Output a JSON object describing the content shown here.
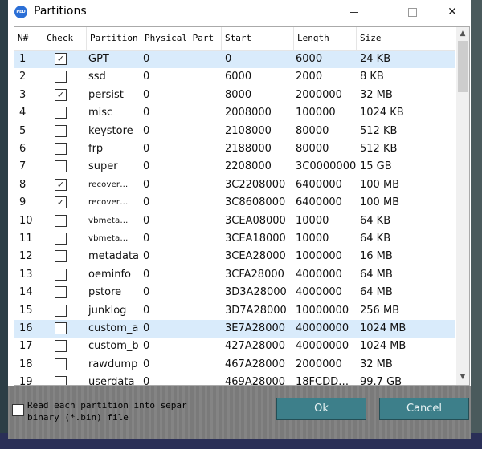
{
  "window": {
    "title": "Partitions",
    "icon_text": "PED"
  },
  "columns": [
    "N#",
    "Check",
    "Partition",
    "Physical Part",
    "Start",
    "Length",
    "Size"
  ],
  "rows": [
    {
      "n": "1",
      "checked": true,
      "partition": "GPT",
      "phys": "0",
      "start": "0",
      "length": "6000",
      "size": "24 KB",
      "selected": true
    },
    {
      "n": "2",
      "checked": false,
      "partition": "ssd",
      "phys": "0",
      "start": "6000",
      "length": "2000",
      "size": "8 KB"
    },
    {
      "n": "3",
      "checked": true,
      "partition": "persist",
      "phys": "0",
      "start": "8000",
      "length": "2000000",
      "size": "32 MB"
    },
    {
      "n": "4",
      "checked": false,
      "partition": "misc",
      "phys": "0",
      "start": "2008000",
      "length": "100000",
      "size": "1024 KB"
    },
    {
      "n": "5",
      "checked": false,
      "partition": "keystore",
      "phys": "0",
      "start": "2108000",
      "length": "80000",
      "size": "512 KB"
    },
    {
      "n": "6",
      "checked": false,
      "partition": "frp",
      "phys": "0",
      "start": "2188000",
      "length": "80000",
      "size": "512 KB"
    },
    {
      "n": "7",
      "checked": false,
      "partition": "super",
      "phys": "0",
      "start": "2208000",
      "length": "3C0000000",
      "size": "15 GB"
    },
    {
      "n": "8",
      "checked": true,
      "partition": "recover…",
      "phys": "0",
      "start": "3C2208000",
      "length": "6400000",
      "size": "100 MB",
      "small": true
    },
    {
      "n": "9",
      "checked": true,
      "partition": "recover…",
      "phys": "0",
      "start": "3C8608000",
      "length": "6400000",
      "size": "100 MB",
      "small": true
    },
    {
      "n": "10",
      "checked": false,
      "partition": "vbmeta…",
      "phys": "0",
      "start": "3CEA08000",
      "length": "10000",
      "size": "64 KB",
      "small": true
    },
    {
      "n": "11",
      "checked": false,
      "partition": "vbmeta…",
      "phys": "0",
      "start": "3CEA18000",
      "length": "10000",
      "size": "64 KB",
      "small": true
    },
    {
      "n": "12",
      "checked": false,
      "partition": "metadata",
      "phys": "0",
      "start": "3CEA28000",
      "length": "1000000",
      "size": "16 MB"
    },
    {
      "n": "13",
      "checked": false,
      "partition": "oeminfo",
      "phys": "0",
      "start": "3CFA28000",
      "length": "4000000",
      "size": "64 MB"
    },
    {
      "n": "14",
      "checked": false,
      "partition": "pstore",
      "phys": "0",
      "start": "3D3A28000",
      "length": "4000000",
      "size": "64 MB"
    },
    {
      "n": "15",
      "checked": false,
      "partition": "junklog",
      "phys": "0",
      "start": "3D7A28000",
      "length": "10000000",
      "size": "256 MB"
    },
    {
      "n": "16",
      "checked": false,
      "partition": "custom_a",
      "phys": "0",
      "start": "3E7A28000",
      "length": "40000000",
      "size": "1024 MB",
      "selected": true
    },
    {
      "n": "17",
      "checked": false,
      "partition": "custom_b",
      "phys": "0",
      "start": "427A28000",
      "length": "40000000",
      "size": "1024 MB"
    },
    {
      "n": "18",
      "checked": false,
      "partition": "rawdump",
      "phys": "0",
      "start": "467A28000",
      "length": "2000000",
      "size": "32 MB"
    },
    {
      "n": "19",
      "checked": false,
      "partition": "userdata",
      "phys": "0",
      "start": "469A28000",
      "length": "18FCDD…",
      "size": "99.7 GB"
    }
  ],
  "options": {
    "read_each_label": "Read each partition into separ binary (*.bin) file",
    "read_each_checked": false
  },
  "buttons": {
    "ok": "Ok",
    "cancel": "Cancel"
  },
  "colors": {
    "selected_row": "#d9ebfb",
    "button_bg": "#3d7f8a",
    "bottom_panel": "#7e7e7e"
  }
}
